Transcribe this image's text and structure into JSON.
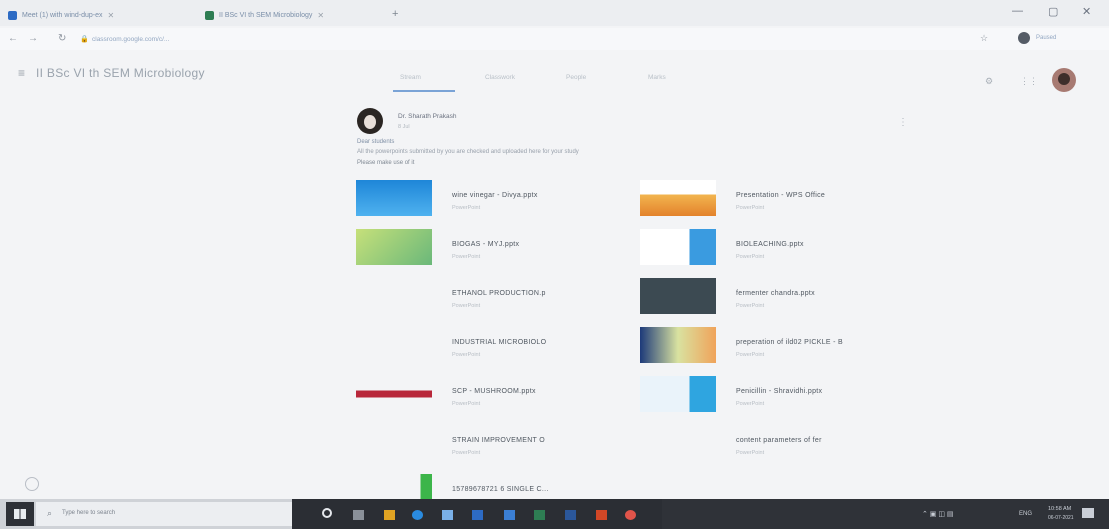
{
  "browser": {
    "tabs": [
      {
        "label": "Meet (1) with wind-dup-ex"
      },
      {
        "label": "II BSc VI th SEM Microbiology"
      }
    ],
    "new_tab": "+",
    "url": "classroom.google.com/c/...",
    "window_controls": [
      "—",
      "▢",
      "✕"
    ],
    "profile_label": "Paused"
  },
  "classroom": {
    "class_title": "II BSc VI th SEM Microbiology",
    "tabs": [
      "Stream",
      "Classwork",
      "People",
      "Marks"
    ],
    "post": {
      "author": "Dr. Sharath Prakash",
      "date": "8 Jul",
      "greeting": "Dear students",
      "body": "All the powerpoints submitted by you are checked and uploaded here for your study",
      "body2": "Please make use of it",
      "attachments": [
        {
          "title": "wine vinegar - Divya.pptx",
          "sub": "PowerPoint",
          "thumb": "blue"
        },
        {
          "title": "Presentation - WPS Office",
          "sub": "PowerPoint",
          "thumb": "orange"
        },
        {
          "title": "BIOGAS - MYJ.pptx",
          "sub": "PowerPoint",
          "thumb": "green"
        },
        {
          "title": "BIOLEACHING.pptx",
          "sub": "PowerPoint",
          "thumb": "blue-right"
        },
        {
          "title": "ETHANOL PRODUCTION.p",
          "sub": "PowerPoint",
          "thumb": "white"
        },
        {
          "title": "fermenter chandra.pptx",
          "sub": "PowerPoint",
          "thumb": "dark"
        },
        {
          "title": "INDUSTRIAL MICROBIOLO",
          "sub": "PowerPoint",
          "thumb": "text"
        },
        {
          "title": "preperation of ild02 PICKLE - B",
          "sub": "PowerPoint",
          "thumb": "pickle"
        },
        {
          "title": "SCP - MUSHROOM.pptx",
          "sub": "PowerPoint",
          "thumb": "red"
        },
        {
          "title": "Penicillin - Shravidhi.pptx",
          "sub": "PowerPoint",
          "thumb": "light-blue"
        },
        {
          "title": "STRAIN IMPROVEMENT O",
          "sub": "PowerPoint",
          "thumb": "lines"
        },
        {
          "title": "content parameters of fer",
          "sub": "PowerPoint",
          "thumb": "lines"
        },
        {
          "title": "15789678721 6 SINGLE C...",
          "sub": "PowerPoint",
          "thumb": "green-ring"
        }
      ]
    }
  },
  "taskbar": {
    "search_placeholder": "Type here to search",
    "lang": "ENG",
    "time": "10:58 AM",
    "date": "06-07-2021"
  },
  "colors": {
    "accent": "#7aa3d6",
    "taskbar": "#2b2e34"
  }
}
